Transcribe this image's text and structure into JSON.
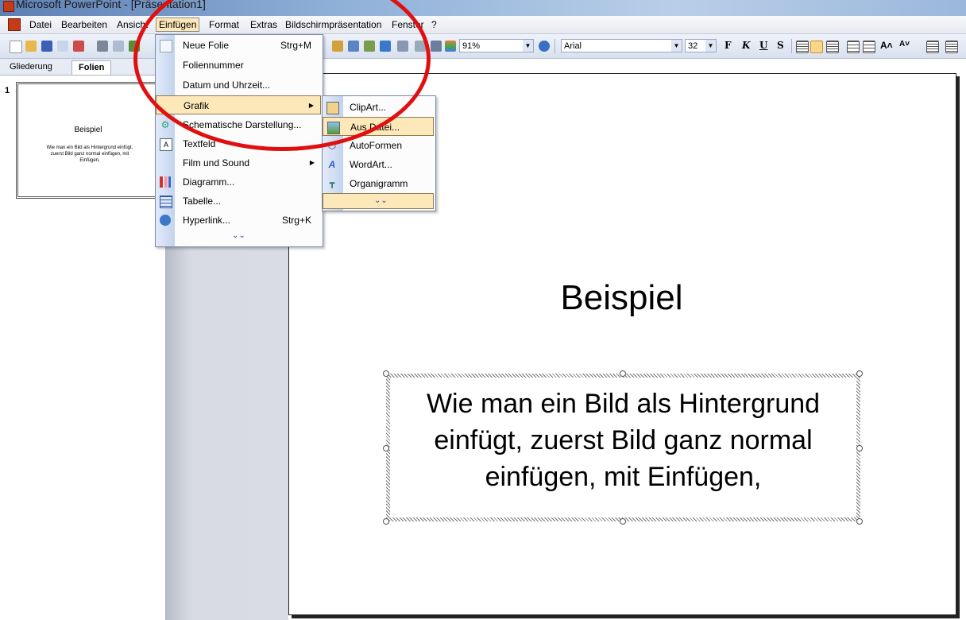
{
  "window": {
    "title": "Microsoft PowerPoint - [Präsentation1]"
  },
  "menubar": {
    "items": [
      "Datei",
      "Bearbeiten",
      "Ansicht",
      "Einfügen",
      "Format",
      "Extras",
      "Bildschirmpräsentation",
      "Fenster",
      "?"
    ],
    "active": "Einfügen"
  },
  "toolbar": {
    "zoom": "91%",
    "font": "Arial",
    "font_size": "32",
    "bold": "F",
    "italic": "K",
    "underline": "U",
    "shadow": "S"
  },
  "leftpane": {
    "tabs": [
      "Gliederung",
      "Folien"
    ],
    "slide_number": "1",
    "thumb_title": "Beispiel",
    "thumb_text": "Wie man ein Bild als Hintergrund einfügt, zuerst Bild ganz normal einfügen, mit Einfügen,"
  },
  "insert_menu": {
    "items": [
      {
        "label": "Neue Folie",
        "shortcut": "Strg+M",
        "icon": "new-slide-icon"
      },
      {
        "label": "Foliennummer",
        "shortcut": "",
        "icon": ""
      },
      {
        "label": "Datum und Uhrzeit...",
        "shortcut": "",
        "icon": ""
      },
      {
        "label": "Grafik",
        "shortcut": "",
        "icon": "",
        "submenu": true
      },
      {
        "label": "Schematische Darstellung...",
        "shortcut": "",
        "icon": "diagram-gallery-icon"
      },
      {
        "label": "Textfeld",
        "shortcut": "",
        "icon": "textbox-icon"
      },
      {
        "label": "Film und Sound",
        "shortcut": "",
        "icon": "",
        "submenu": true
      },
      {
        "label": "Diagramm...",
        "shortcut": "",
        "icon": "chart-icon"
      },
      {
        "label": "Tabelle...",
        "shortcut": "",
        "icon": "table-icon"
      },
      {
        "label": "Hyperlink...",
        "shortcut": "Strg+K",
        "icon": "hyperlink-icon"
      }
    ]
  },
  "picture_submenu": {
    "items": [
      {
        "label": "ClipArt...",
        "icon": "clipart-icon"
      },
      {
        "label": "Aus Datei...",
        "icon": "from-file-icon"
      },
      {
        "label": "AutoFormen",
        "icon": "autoshapes-icon"
      },
      {
        "label": "WordArt...",
        "icon": "wordart-icon"
      },
      {
        "label": "Organigramm",
        "icon": "org-chart-icon"
      }
    ]
  },
  "slide": {
    "title": "Beispiel",
    "body": "Wie man ein Bild als Hintergrund einfügt, zuerst Bild ganz normal einfügen, mit Einfügen,"
  },
  "colors": {
    "accent": "#fde8b9",
    "annotation": "#e01010",
    "menu_border": "#7a8aa8"
  }
}
